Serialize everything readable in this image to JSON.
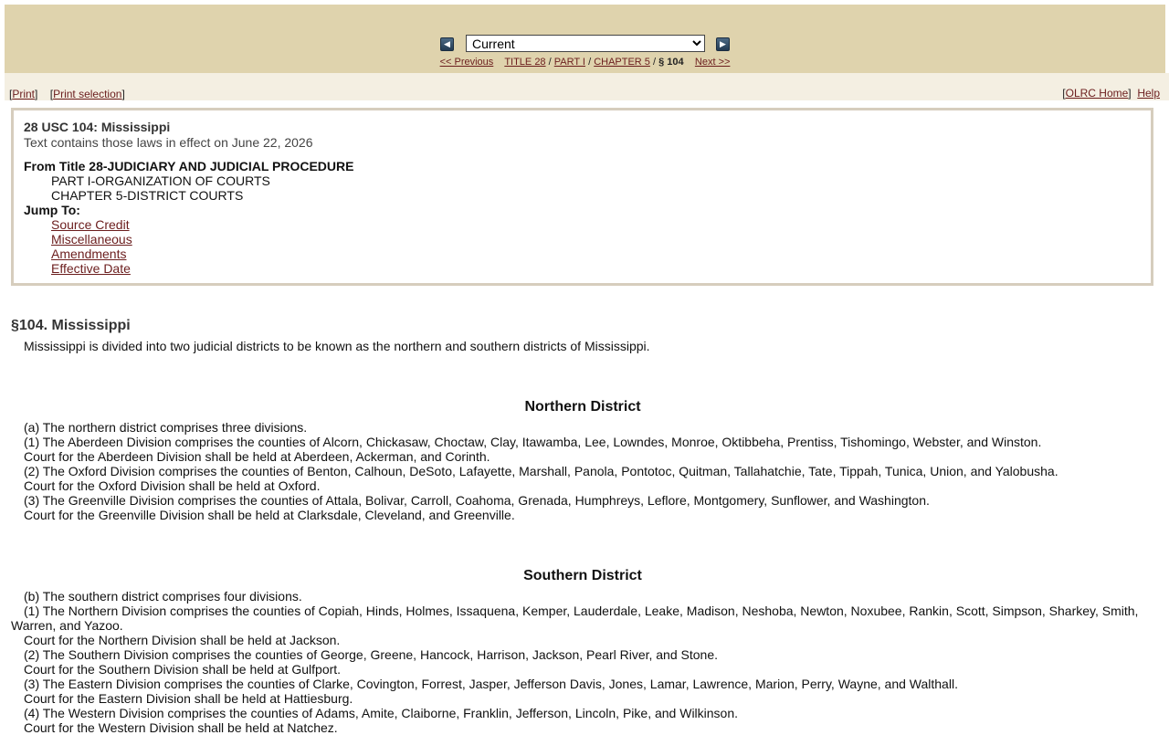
{
  "nav": {
    "version_selected": "Current",
    "prev_label": "<< Previous",
    "title_label": "TITLE 28",
    "part_label": "PART I",
    "chapter_label": "CHAPTER 5",
    "current_label": "§ 104",
    "next_label": "Next >>",
    "separator": "/"
  },
  "toolbar": {
    "print_label": "Print",
    "print_selection_label": "Print selection",
    "home_label": "OLRC Home",
    "help_label": "Help"
  },
  "info": {
    "citation": "28 USC 104: Mississippi",
    "effective": "Text contains those laws in effect on June 22, 2026",
    "from_title": "From Title 28-JUDICIARY AND JUDICIAL PROCEDURE",
    "part": "PART I-ORGANIZATION OF COURTS",
    "chapter": "CHAPTER 5-DISTRICT COURTS",
    "jump_label": "Jump To:",
    "jump_links": [
      "Source Credit",
      "Miscellaneous",
      "Amendments",
      "Effective Date"
    ]
  },
  "section": {
    "heading": "§104. Mississippi",
    "intro": "Mississippi is divided into two judicial districts to be known as the northern and southern districts of Mississippi."
  },
  "northern": {
    "heading": "Northern District",
    "lines": [
      "(a) The northern district comprises three divisions.",
      "(1) The Aberdeen Division comprises the counties of Alcorn, Chickasaw, Choctaw, Clay, Itawamba, Lee, Lowndes, Monroe, Oktibbeha, Prentiss, Tishomingo, Webster, and Winston.",
      "Court for the Aberdeen Division shall be held at Aberdeen, Ackerman, and Corinth.",
      "(2) The Oxford Division comprises the counties of Benton, Calhoun, DeSoto, Lafayette, Marshall, Panola, Pontotoc, Quitman, Tallahatchie, Tate, Tippah, Tunica, Union, and Yalobusha.",
      "Court for the Oxford Division shall be held at Oxford.",
      "(3) The Greenville Division comprises the counties of Attala, Bolivar, Carroll, Coahoma, Grenada, Humphreys, Leflore, Montgomery, Sunflower, and Washington.",
      "Court for the Greenville Division shall be held at Clarksdale, Cleveland, and Greenville."
    ]
  },
  "southern": {
    "heading": "Southern District",
    "intro": "(b) The southern district comprises four divisions.",
    "northern_div": "(1) The Northern Division comprises the counties of Copiah, Hinds, Holmes, Issaquena, Kemper, Lauderdale, Leake, Madison, Neshoba, Newton, Noxubee, Rankin, Scott, Simpson, Sharkey, Smith, Warren, and Yazoo.",
    "lines": [
      "Court for the Northern Division shall be held at Jackson.",
      "(2) The Southern Division comprises the counties of George, Greene, Hancock, Harrison, Jackson, Pearl River, and Stone.",
      "Court for the Southern Division shall be held at Gulfport.",
      "(3) The Eastern Division comprises the counties of Clarke, Covington, Forrest, Jasper, Jefferson Davis, Jones, Lamar, Lawrence, Marion, Perry, Wayne, and Walthall.",
      "Court for the Eastern Division shall be held at Hattiesburg.",
      "(4) The Western Division comprises the counties of Adams, Amite, Claiborne, Franklin, Jefferson, Lincoln, Pike, and Wilkinson.",
      "Court for the Western Division shall be held at Natchez."
    ]
  }
}
